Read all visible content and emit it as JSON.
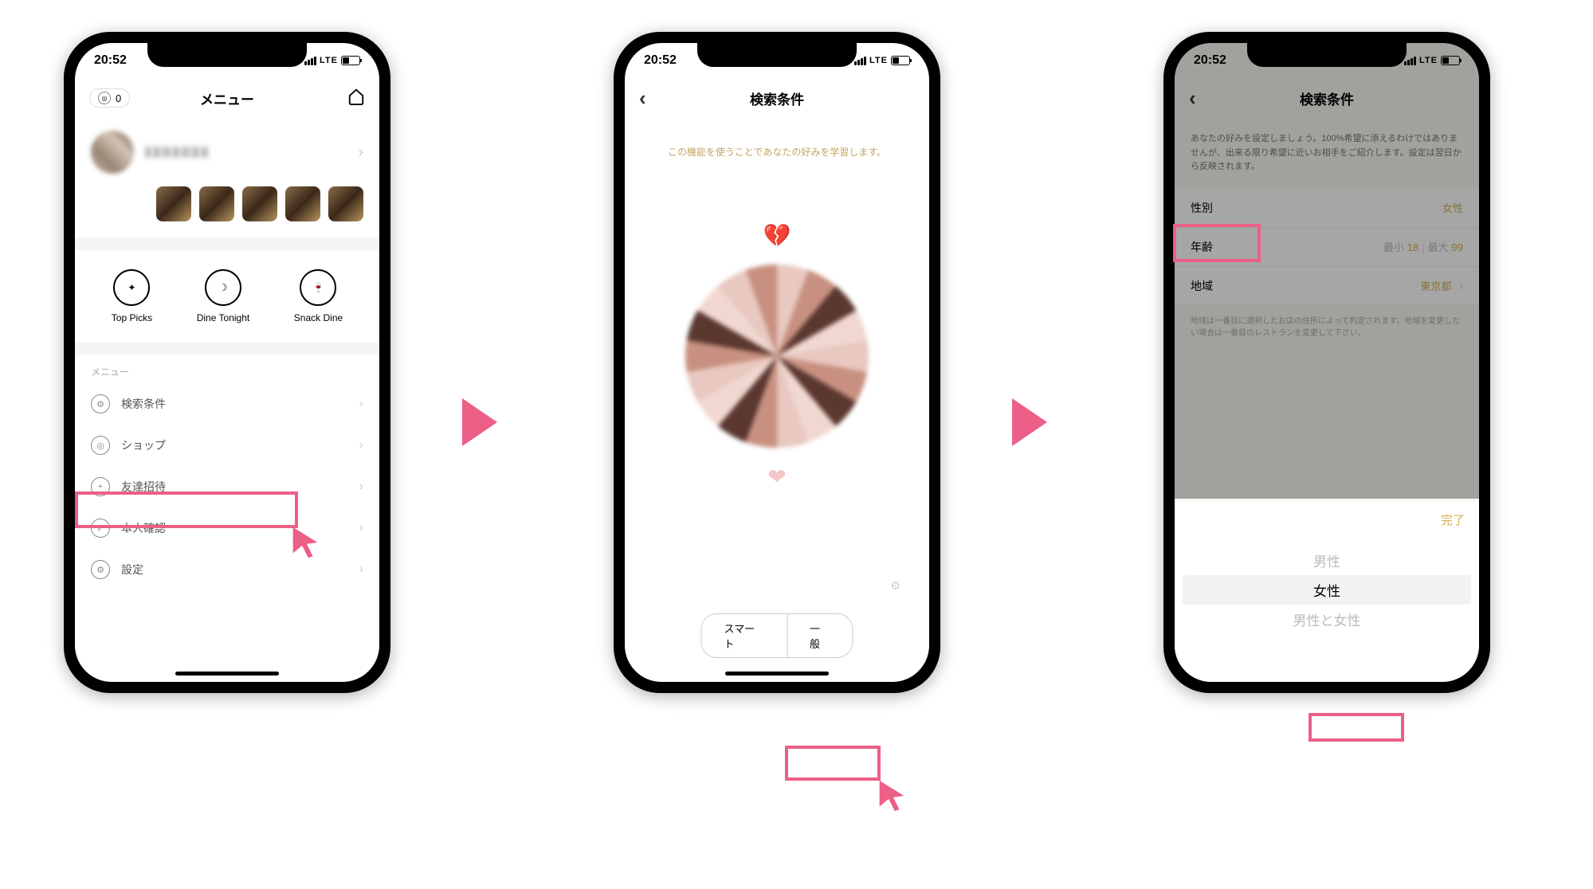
{
  "status": {
    "time": "20:52",
    "network": "LTE"
  },
  "screen1": {
    "title": "メニュー",
    "coin_count": "0",
    "actions": [
      {
        "key": "top-picks",
        "label": "Top Picks"
      },
      {
        "key": "dine-tonight",
        "label": "Dine Tonight"
      },
      {
        "key": "snack-dine",
        "label": "Snack Dine"
      }
    ],
    "section_label": "メニュー",
    "menu": [
      {
        "key": "search",
        "label": "検索条件"
      },
      {
        "key": "shop",
        "label": "ショップ"
      },
      {
        "key": "invite",
        "label": "友達招待"
      },
      {
        "key": "verify",
        "label": "本人確認"
      },
      {
        "key": "settings",
        "label": "設定"
      }
    ]
  },
  "screen2": {
    "title": "検索条件",
    "description": "この機能を使うことであなたの好みを学習します。",
    "tabs": {
      "smart": "スマート",
      "general": "一般"
    }
  },
  "screen3": {
    "title": "検索条件",
    "description": "あなたの好みを設定しましょう。100%希望に添えるわけではありませんが、出来る限り希望に近いお相手をご紹介します。設定は翌日から反映されます。",
    "rows": {
      "gender": {
        "label": "性別",
        "value": "女性"
      },
      "age": {
        "label": "年齢",
        "min_label": "最小",
        "min_value": "18",
        "max_label": "最大",
        "max_value": "99"
      },
      "region": {
        "label": "地域",
        "value": "東京都"
      }
    },
    "footnote": "地域は一番目に選択したお店の住所によって判定されます。地域を変更したい場合は一番目のレストランを変更して下さい。",
    "picker": {
      "done": "完了",
      "options": [
        "男性",
        "女性",
        "男性と女性"
      ],
      "selected": "女性"
    }
  }
}
